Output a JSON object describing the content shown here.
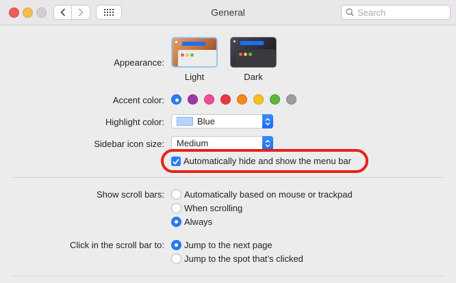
{
  "window": {
    "title": "General",
    "search_placeholder": "Search"
  },
  "appearance": {
    "label": "Appearance:",
    "options": [
      {
        "caption": "Light",
        "selected": true
      },
      {
        "caption": "Dark",
        "selected": false
      }
    ]
  },
  "accent": {
    "label": "Accent color:",
    "colors": [
      {
        "name": "blue",
        "hex": "#2a7cf5",
        "selected": true
      },
      {
        "name": "purple",
        "hex": "#9b3aa6"
      },
      {
        "name": "pink",
        "hex": "#ee4c9a"
      },
      {
        "name": "red",
        "hex": "#e9393d"
      },
      {
        "name": "orange",
        "hex": "#f48a1c"
      },
      {
        "name": "yellow",
        "hex": "#f7c11f"
      },
      {
        "name": "green",
        "hex": "#5cb73a"
      },
      {
        "name": "graphite",
        "hex": "#9d9d9d"
      }
    ]
  },
  "highlight": {
    "label": "Highlight color:",
    "value": "Blue",
    "swatch_color": "#b5d5ff"
  },
  "sidebar_icon_size": {
    "label": "Sidebar icon size:",
    "value": "Medium"
  },
  "menu_bar": {
    "label": "Automatically hide and show the menu bar",
    "checked": true,
    "annotation_color": "#e8211a"
  },
  "scroll_bars": {
    "label": "Show scroll bars:",
    "options": [
      {
        "label": "Automatically based on mouse or trackpad",
        "selected": false
      },
      {
        "label": "When scrolling",
        "selected": false
      },
      {
        "label": "Always",
        "selected": true
      }
    ]
  },
  "scroll_click": {
    "label": "Click in the scroll bar to:",
    "options": [
      {
        "label": "Jump to the next page",
        "selected": true
      },
      {
        "label": "Jump to the spot that’s clicked",
        "selected": false
      }
    ]
  }
}
